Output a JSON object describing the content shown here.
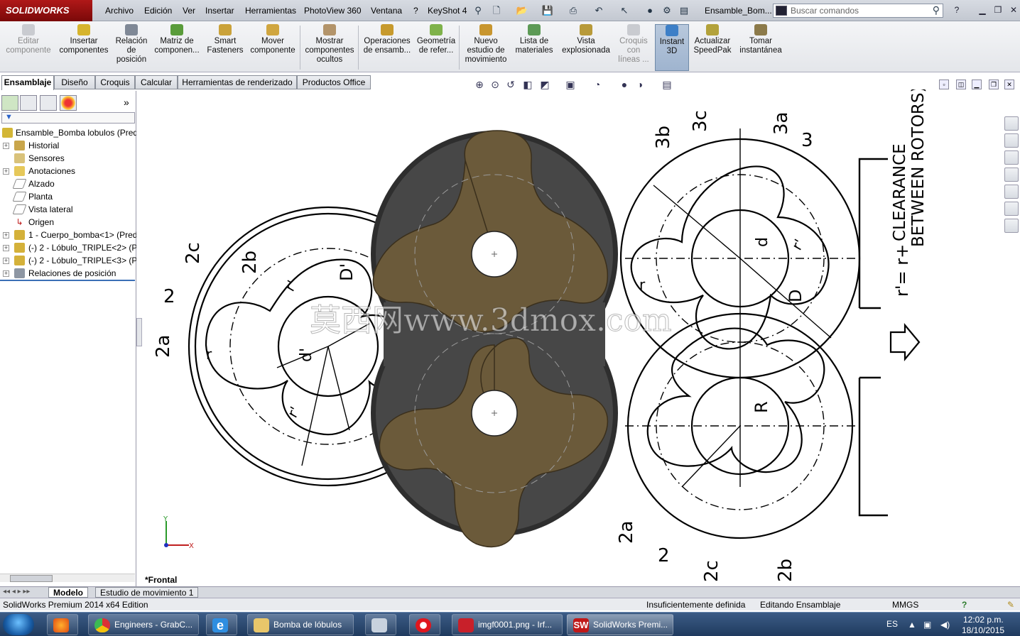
{
  "app": {
    "logo_text": "SOLIDWORKS",
    "document_title": "Ensamble_Bom...",
    "search_placeholder": "Buscar comandos"
  },
  "menu": [
    "Archivo",
    "Edición",
    "Ver",
    "Insertar",
    "Herramientas",
    "PhotoView 360",
    "Ventana",
    "?",
    "KeyShot 4"
  ],
  "commands": [
    {
      "label": "Editar componente",
      "disabled": true
    },
    {
      "label": "Insertar componentes"
    },
    {
      "label": "Relación de posición"
    },
    {
      "label": "Matriz de componen..."
    },
    {
      "label": "Smart Fasteners"
    },
    {
      "label": "Mover componente"
    },
    {
      "label": "Mostrar componentes ocultos"
    },
    {
      "label": "Operaciones de ensamb..."
    },
    {
      "label": "Geometría de refer..."
    },
    {
      "label": "Nuevo estudio de movimiento"
    },
    {
      "label": "Lista de materiales"
    },
    {
      "label": "Vista explosionada"
    },
    {
      "label": "Croquis con líneas ...",
      "disabled": true
    },
    {
      "label": "Instant 3D",
      "active": true
    },
    {
      "label": "Actualizar SpeedPak"
    },
    {
      "label": "Tomar instantánea"
    }
  ],
  "tabs": [
    "Ensamblaje",
    "Diseño",
    "Croquis",
    "Calcular",
    "Herramientas de renderizado",
    "Productos Office"
  ],
  "active_tab": "Ensamblaje",
  "tree": {
    "root": "Ensamble_Bomba lobulos  (Pred",
    "items": [
      {
        "label": "Historial",
        "expand": true
      },
      {
        "label": "Sensores",
        "expand": false
      },
      {
        "label": "Anotaciones",
        "expand": true
      },
      {
        "label": "Alzado",
        "expand": false
      },
      {
        "label": "Planta",
        "expand": false
      },
      {
        "label": "Vista lateral",
        "expand": false
      },
      {
        "label": "Origen",
        "expand": false
      },
      {
        "label": "1 - Cuerpo_bomba<1> (Pred",
        "expand": true
      },
      {
        "label": "(-) 2 - Lóbulo_TRIPLE<2> (Pr",
        "expand": true
      },
      {
        "label": "(-) 2 - Lóbulo_TRIPLE<3> (Pr",
        "expand": true
      },
      {
        "label": "Relaciones de posición",
        "expand": true
      }
    ]
  },
  "graphics": {
    "view_name": "*Frontal",
    "watermark": "莫西网www.3dmox.com",
    "triad_x": "X",
    "triad_y": "Y",
    "drawing_labels": {
      "l2": "2",
      "l2a": "2a",
      "l2b": "2b",
      "l2c": "2c",
      "r3": "3",
      "r3a": "3a",
      "r3b": "3b",
      "r3c": "3c",
      "r": "r",
      "rp": "r'",
      "d": "d",
      "dp": "d'",
      "D": "D",
      "Dp": "D'",
      "R": "R",
      "formula": "r'= r+",
      "clearance_1": "CLEARANCE",
      "clearance_2": "BETWEEN ROTORS)"
    }
  },
  "bottom_tabs": [
    "Modelo",
    "Estudio de movimiento 1"
  ],
  "active_bottom_tab": "Modelo",
  "status": {
    "edition": "SolidWorks Premium 2014 x64 Edition",
    "definition": "Insuficientemente definida",
    "mode": "Editando Ensamblaje",
    "units": "MMGS"
  },
  "taskbar": {
    "tasks": [
      "Engineers - GrabC...",
      "Bomba de lóbulos",
      "imgf0001.png - Irf...",
      "SolidWorks Premi..."
    ],
    "language": "ES",
    "time": "12:02 p.m.",
    "date": "18/10/2015"
  },
  "colors": {
    "lobe_fill": "#6b5a3a",
    "casing_fill": "#474747",
    "brand_red": "#a01010",
    "taskbar_blue": "#2a4770"
  }
}
